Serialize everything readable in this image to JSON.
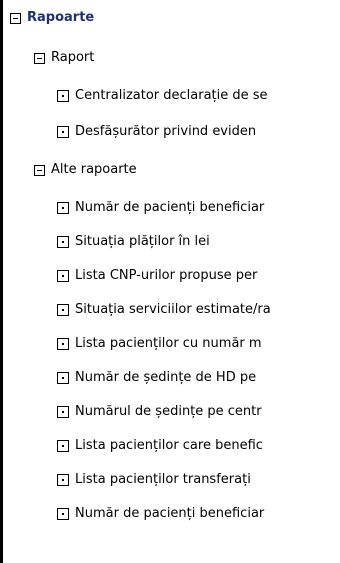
{
  "tree": {
    "root": {
      "label": "Rapoarte",
      "icon": "collapse-icon",
      "color": "#1f2f78"
    },
    "group1": {
      "label": "Raport",
      "icon": "collapse-icon",
      "items": [
        "Centralizator declarație de se",
        "Desfășurător privind eviden"
      ]
    },
    "group2": {
      "label": "Alte rapoarte",
      "icon": "collapse-icon",
      "items": [
        "Număr de pacienți beneficiar",
        "Situația plăților în lei",
        "Lista CNP-urilor propuse per",
        "Situația serviciilor estimate/ra",
        "Lista pacienților cu număr m",
        "Număr de ședințe de HD pe",
        "Numărul de ședințe pe centr",
        "Lista pacienților care benefic",
        "Lista pacienților transferați",
        "Număr de pacienți beneficiar"
      ]
    },
    "leaf_icon": "document-leaf-icon"
  }
}
